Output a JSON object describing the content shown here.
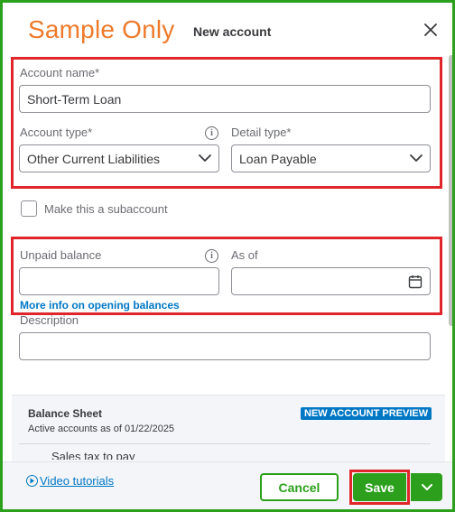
{
  "watermark": "Sample Only",
  "panel": {
    "title": "New account",
    "close_icon": "close-x-icon"
  },
  "form": {
    "account_name": {
      "label": "Account name*",
      "value": "Short-Term Loan"
    },
    "account_type": {
      "label": "Account type*",
      "value": "Other Current Liabilities"
    },
    "detail_type": {
      "label": "Detail type*",
      "value": "Loan Payable"
    },
    "subaccount": {
      "label": "Make this a subaccount",
      "checked": false
    },
    "unpaid_balance": {
      "label": "Unpaid balance",
      "value": ""
    },
    "as_of": {
      "label": "As of",
      "value": ""
    },
    "more_info_link": "More info on opening balances",
    "description": {
      "label": "Description",
      "value": ""
    }
  },
  "balance_sheet": {
    "title": "Balance Sheet",
    "subtitle": "Active accounts as of 01/22/2025",
    "badge": "NEW ACCOUNT PREVIEW",
    "row_label": "Sales tax to pay"
  },
  "footer": {
    "video_link": "Video tutorials",
    "cancel_label": "Cancel",
    "save_label": "Save"
  },
  "colors": {
    "brand_green": "#2ca01c",
    "highlight_red": "#e0262a",
    "link_blue": "#0077c5",
    "watermark_orange": "#ef7a2b"
  }
}
